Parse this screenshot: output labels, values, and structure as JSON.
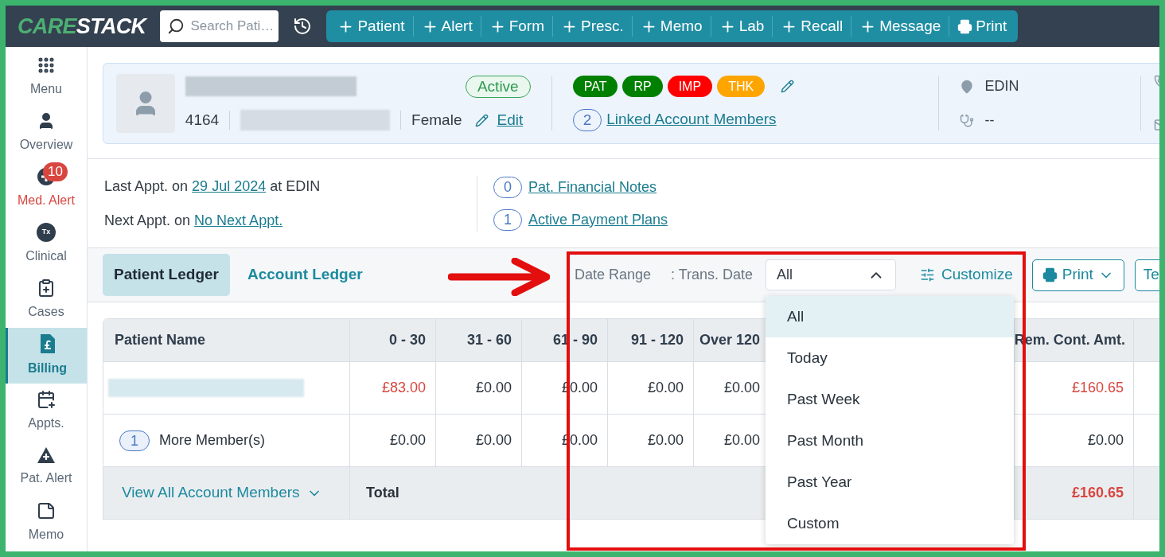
{
  "logo": {
    "part_1": "CARE",
    "part_2": "STACK"
  },
  "search": {
    "placeholder": "Search Pati…"
  },
  "toolbar_buttons": [
    {
      "kind": "add",
      "label": "Patient"
    },
    {
      "kind": "add",
      "label": "Alert"
    },
    {
      "kind": "add",
      "label": "Form"
    },
    {
      "kind": "add",
      "label": "Presc."
    },
    {
      "kind": "add",
      "label": "Memo"
    },
    {
      "kind": "add",
      "label": "Lab"
    },
    {
      "kind": "add",
      "label": "Recall"
    },
    {
      "kind": "add",
      "label": "Message"
    },
    {
      "kind": "print",
      "label": "Print"
    }
  ],
  "sidebar": {
    "items": [
      {
        "kind": "menu",
        "label": "Menu",
        "selected": false
      },
      {
        "kind": "overview",
        "label": "Overview",
        "selected": false
      },
      {
        "kind": "med_alert",
        "label": "Med. Alert",
        "badge": "10",
        "selected": false
      },
      {
        "kind": "clinical",
        "label": "Clinical",
        "icon_text": "Tx",
        "selected": false
      },
      {
        "kind": "cases",
        "label": "Cases",
        "selected": false
      },
      {
        "kind": "billing",
        "label": "Billing",
        "selected": true
      },
      {
        "kind": "appts",
        "label": "Appts.",
        "selected": false
      },
      {
        "kind": "pat_alert",
        "label": "Pat. Alert",
        "selected": false
      },
      {
        "kind": "memo",
        "label": "Memo",
        "selected": false
      }
    ]
  },
  "patient": {
    "status": "Active",
    "id": "4164",
    "gender": "Female",
    "edit": "Edit",
    "tags": [
      {
        "label": "PAT",
        "color": "#008000"
      },
      {
        "label": "RP",
        "color": "#008000"
      },
      {
        "label": "IMP",
        "color": "#ff0000"
      },
      {
        "label": "THK",
        "color": "#ffa500"
      }
    ],
    "linked_count": "2",
    "linked_label": "Linked Account Members",
    "location": "EDIN",
    "provider": "--"
  },
  "appointments": {
    "last_prefix": "Last Appt. on",
    "last_date": "29 Jul 2024",
    "last_suffix": "at EDIN",
    "next_prefix": "Next Appt. on",
    "next_link": "No Next Appt.",
    "notes": [
      {
        "count": "0",
        "label": "Pat. Financial Notes"
      },
      {
        "count": "1",
        "label": "Active Payment Plans"
      }
    ]
  },
  "ledger_tabs": [
    {
      "label": "Patient Ledger",
      "selected": true
    },
    {
      "label": "Account Ledger",
      "selected": false
    }
  ],
  "filters": {
    "date_range_label": "Date Range",
    "trans_label": ": Trans. Date",
    "value": "All",
    "expanded": true,
    "customize": "Customize",
    "print": "Print",
    "next_button": "Te",
    "options": [
      {
        "label": "All",
        "selected": true
      },
      {
        "label": "Today",
        "selected": false
      },
      {
        "label": "Past Week",
        "selected": false
      },
      {
        "label": "Past Month",
        "selected": false
      },
      {
        "label": "Past Year",
        "selected": false
      },
      {
        "label": "Custom",
        "selected": false
      }
    ]
  },
  "table": {
    "columns": [
      "Patient Name",
      "0 - 30",
      "31 - 60",
      "61 - 90",
      "91 - 120",
      "Over 120",
      "Rem. Cont. Amt."
    ],
    "rows": [
      {
        "kind": "patient",
        "cells": [
          {
            "text": ""
          },
          {
            "text": "£83.00",
            "alert": true
          },
          {
            "text": "£0.00",
            "alert": false
          },
          {
            "text": "£0.00",
            "alert": false
          },
          {
            "text": "£0.00",
            "alert": false
          },
          {
            "text": "£0.00",
            "alert": false
          },
          {
            "text": "£160.65",
            "alert": true
          }
        ]
      },
      {
        "kind": "members",
        "count": "1",
        "cells": [
          {
            "text": "More Member(s)"
          },
          {
            "text": "£0.00",
            "alert": false
          },
          {
            "text": "£0.00",
            "alert": false
          },
          {
            "text": "£0.00",
            "alert": false
          },
          {
            "text": "£0.00",
            "alert": false
          },
          {
            "text": "£0.00",
            "alert": false
          },
          {
            "text": "£0.00",
            "alert": false
          }
        ]
      }
    ],
    "footer": {
      "view_all": "View All Account Members",
      "total_label": "Total",
      "total": "£160.65"
    }
  }
}
